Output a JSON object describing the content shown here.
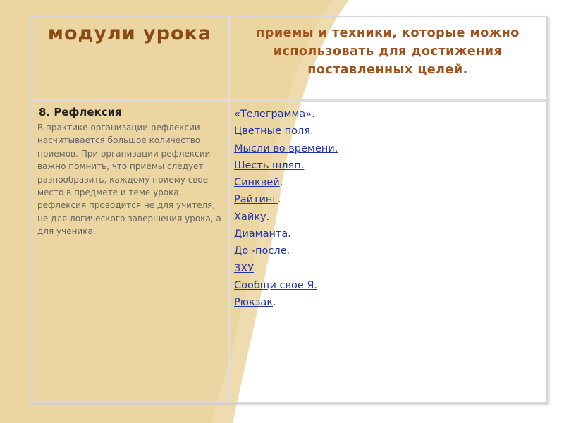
{
  "header": {
    "left": "модули урока",
    "right": "приемы и техники, которые можно использовать для достижения поставленных целей."
  },
  "section": {
    "title": "8. Рефлексия",
    "description": "В практике организации рефлексии насчитывается большое количество приемов. При организации рефлексии важно помнить, что приемы следует разнообразить, каждому приему свое место в предмете и теме урока, рефлексия проводится не для учителя, не для логического завершения урока, а для ученика."
  },
  "techniques": [
    {
      "text": "«Телеграмма».",
      "suffix": ""
    },
    {
      "text": "Цветные  поля.",
      "suffix": ""
    },
    {
      "text": "Мысли во времени.",
      "suffix": ""
    },
    {
      "text": "Шесть шляп.",
      "suffix": ""
    },
    {
      "text": "Синквей",
      "suffix": "."
    },
    {
      "text": "Райтинг",
      "suffix": "."
    },
    {
      "text": "Хайку",
      "suffix": "."
    },
    {
      "text": "Диаманта",
      "suffix": "."
    },
    {
      "text": "До -после.",
      "suffix": ""
    },
    {
      "text": "ЗХУ",
      "suffix": ""
    },
    {
      "text": "Сообщи свое Я.",
      "suffix": ""
    },
    {
      "text": "Рюкзак",
      "suffix": "."
    }
  ]
}
